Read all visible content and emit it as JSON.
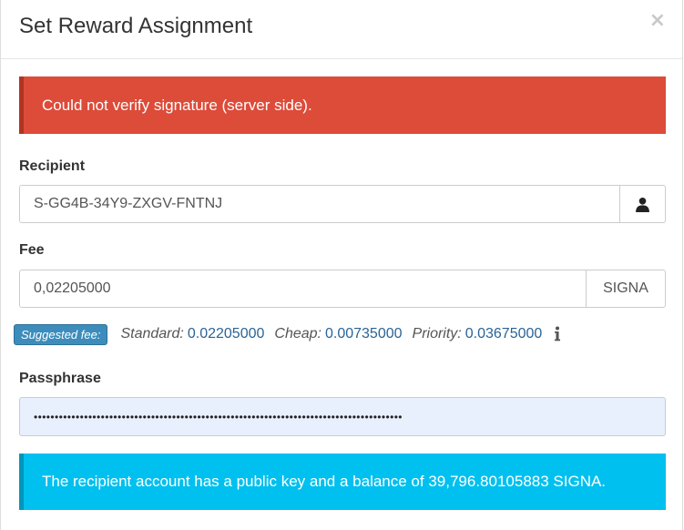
{
  "modal": {
    "title": "Set Reward Assignment",
    "close_symbol": "×"
  },
  "error_alert": {
    "text": "Could not verify signature (server side)."
  },
  "recipient": {
    "label": "Recipient",
    "value": "S-GG4B-34Y9-ZXGV-FNTNJ",
    "icon": "user-icon"
  },
  "fee": {
    "label": "Fee",
    "value": "0,02205000",
    "unit": "SIGNA"
  },
  "suggested_fee": {
    "badge": "Suggested fee:",
    "standard_label": "Standard:",
    "standard_value": "0.02205000",
    "cheap_label": "Cheap:",
    "cheap_value": "0.00735000",
    "priority_label": "Priority:",
    "priority_value": "0.03675000",
    "info_icon": "info-icon"
  },
  "passphrase": {
    "label": "Passphrase",
    "value": "••••••••••••••••••••••••••••••••••••••••••••••••••••••••••••••••••••••••••••••••••••••••"
  },
  "info_alert": {
    "text": "The recipient account has a public key and a balance of 39,796.80105883 SIGNA."
  },
  "colors": {
    "danger": "#dd4b39",
    "info": "#00c0ef",
    "primary": "#3c8dbc",
    "link": "#2a6496"
  }
}
